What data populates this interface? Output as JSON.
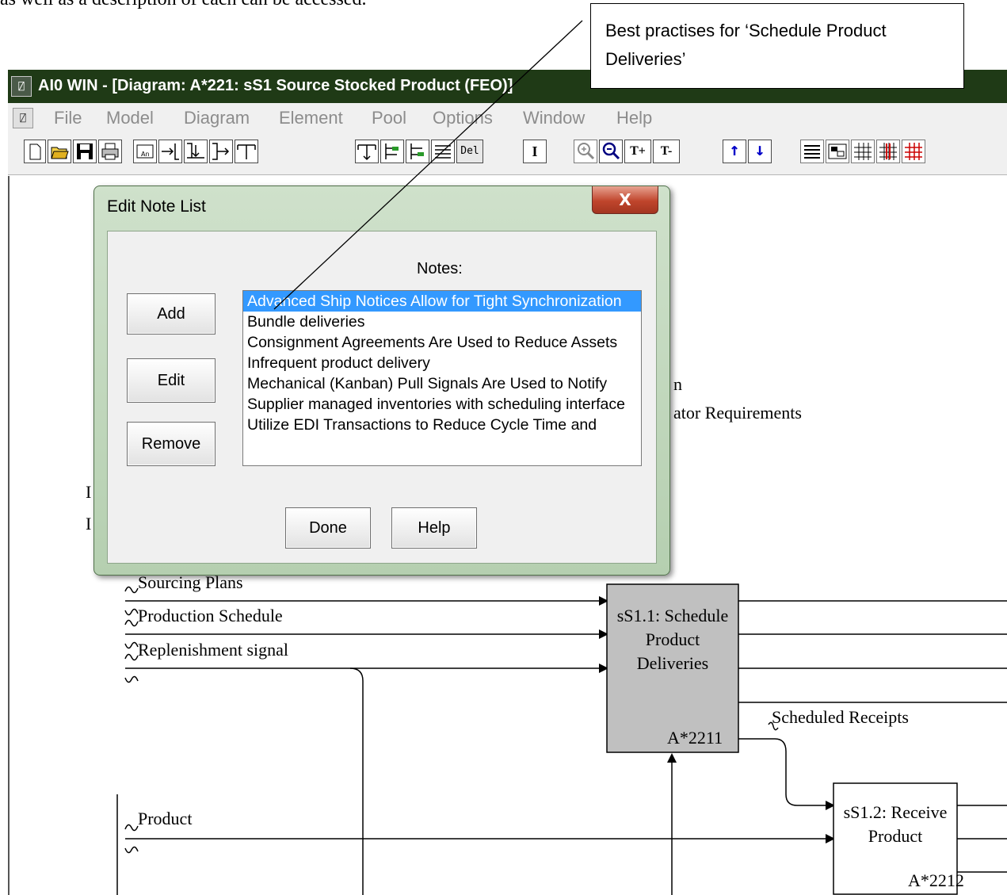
{
  "document": {
    "text_fragment": "as well as a description of each can be accessed."
  },
  "callout": {
    "text": "Best practises for ‘Schedule Product Deliveries’"
  },
  "window": {
    "title": "AI0 WIN  - [Diagram: A*221: sS1 Source Stocked Product (FEO)]",
    "app_icon_glyph": "⍁"
  },
  "menu": {
    "items": [
      "File",
      "Model",
      "Diagram",
      "Element",
      "Pool",
      "Options",
      "Window",
      "Help"
    ]
  },
  "toolbar": {
    "del_label": "Del",
    "text_tool_label": "I",
    "text_bigger_label": "T+",
    "text_smaller_label": "T-",
    "up_glyph": "↑",
    "down_glyph": "↓",
    "icons": [
      "new-file-icon",
      "open-folder-icon",
      "save-disk-icon",
      "print-icon",
      "note-box-icon",
      "arrow-join-left-icon",
      "arrow-join-up-icon",
      "arrow-join-right-icon",
      "arrow-branch-down-icon",
      "arrow-branch-up-icon",
      "data-left-icon",
      "data-right-icon",
      "list-lines-icon",
      "delete-icon",
      "text-tool-icon",
      "zoom-in-icon",
      "zoom-out-icon",
      "text-bigger-icon",
      "text-smaller-icon",
      "move-up-icon",
      "move-down-icon",
      "align-icon",
      "diagram-icon",
      "grid-icon",
      "grid-bold-icon",
      "grid-red-icon"
    ]
  },
  "dialog": {
    "title": "Edit Note List",
    "close_label": "X",
    "notes_label": "Notes:",
    "buttons": {
      "add": "Add",
      "edit": "Edit",
      "remove": "Remove",
      "done": "Done",
      "help": "Help"
    },
    "notes": [
      "Advanced Ship Notices Allow for Tight Synchronization",
      "Bundle deliveries",
      "Consignment Agreements Are Used to Reduce Assets",
      "Infrequent product delivery",
      "Mechanical (Kanban) Pull Signals Are Used to Notify",
      "Supplier managed inventories with scheduling interface",
      "Utilize EDI Transactions to Reduce Cycle Time and"
    ],
    "selected_index": 0
  },
  "diagram": {
    "partial_labels": [
      "n",
      "ator Requirements",
      "I",
      "I"
    ],
    "inputs": [
      "Sourcing Plans",
      "Production Schedule",
      "Replenishment signal",
      "Product"
    ],
    "activity1": {
      "title": "sS1.1: Schedule Product Deliveries",
      "node": "A*2211",
      "fill": "#c0c0c0"
    },
    "activity2": {
      "title": "sS1.2: Receive Product",
      "node": "A*2212",
      "fill": "#ffffff"
    },
    "output_label": "Scheduled Receipts"
  }
}
